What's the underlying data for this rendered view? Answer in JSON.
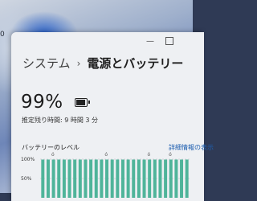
{
  "wallpaper": {
    "partial_text": "0"
  },
  "window": {
    "controls": [
      "minimize-icon",
      "maximize-icon"
    ]
  },
  "breadcrumb": {
    "parent": "システム",
    "separator": "›",
    "current": "電源とバッテリー"
  },
  "battery": {
    "percent_label": "99%",
    "level_fraction": 0.99,
    "icon": "battery-full-icon",
    "remaining_label": "推定残り時間: 9 時間 3 分"
  },
  "usage": {
    "title": "バッテリーのレベル",
    "details_link": "詳細情報の表示",
    "accent_color": "#4fb49a"
  },
  "chart_data": {
    "type": "bar",
    "ylabel": "",
    "y_ticks": [
      "100%",
      "50%"
    ],
    "ylim": [
      0,
      100
    ],
    "values": [
      99,
      99,
      99,
      99,
      99,
      99,
      99,
      99,
      99,
      99,
      99,
      99,
      99,
      99,
      99,
      99,
      99,
      99,
      99,
      99,
      99,
      99,
      99,
      99,
      99,
      99,
      99,
      99
    ],
    "plug_markers": [
      2,
      12,
      20,
      24
    ],
    "grid": true
  }
}
